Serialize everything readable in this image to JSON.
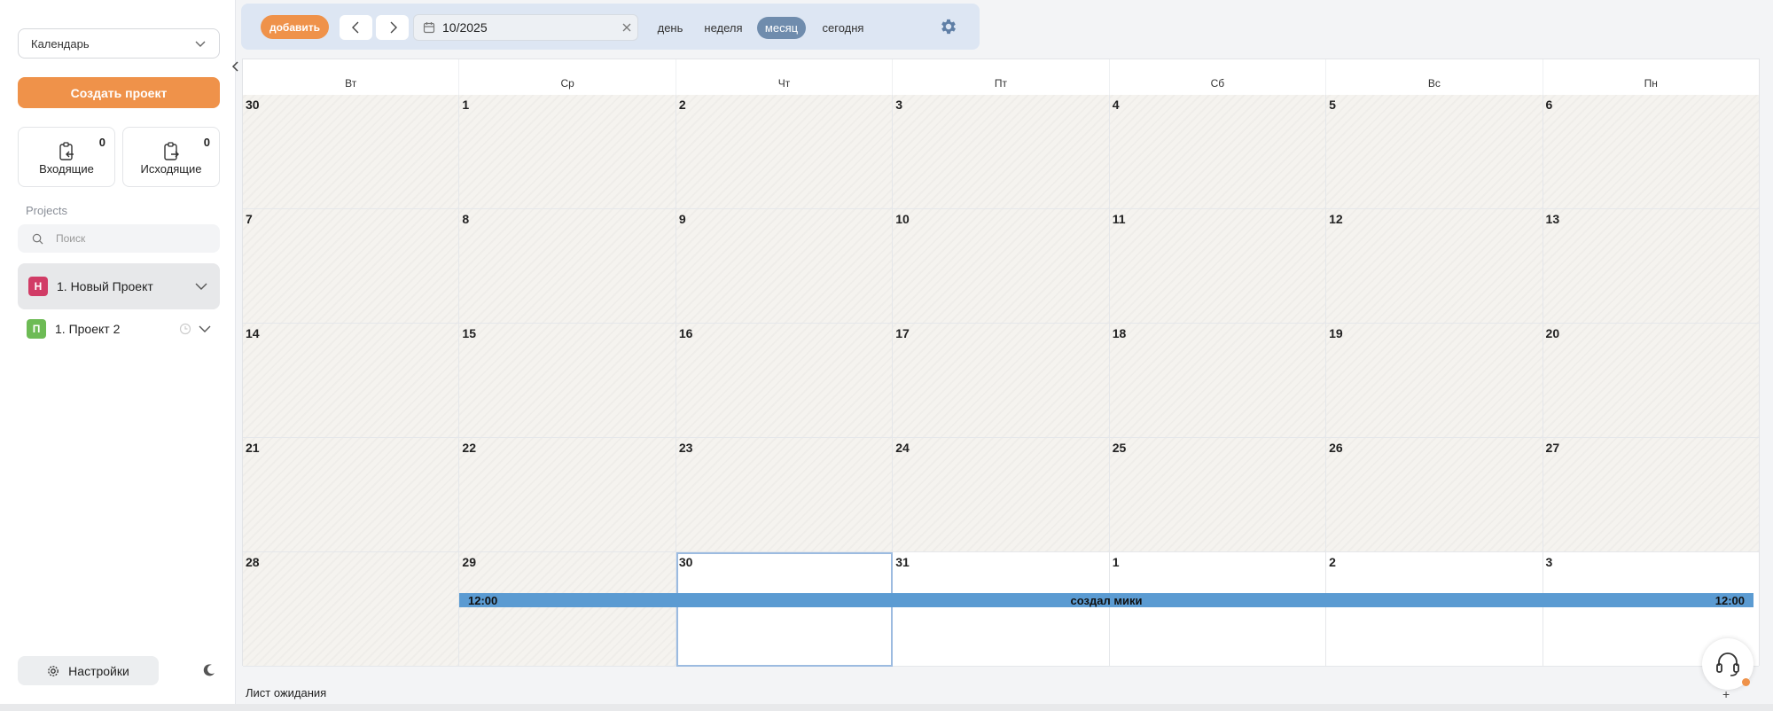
{
  "sidebar": {
    "calendar_select": "Календарь",
    "create_project": "Создать проект",
    "incoming": {
      "label": "Входящие",
      "count": "0"
    },
    "outgoing": {
      "label": "Исходящие",
      "count": "0"
    },
    "projects_label": "Projects",
    "search_placeholder": "Поиск",
    "projects": [
      {
        "badge": "Н",
        "name": "1. Новый Проект",
        "color": "#d13c66"
      },
      {
        "badge": "П",
        "name": "1. Проект 2",
        "color": "#6dbb55"
      }
    ],
    "settings_label": "Настройки"
  },
  "toolbar": {
    "add_label": "добавить",
    "date_value": "10/2025",
    "views": {
      "day": "день",
      "week": "неделя",
      "month": "месяц",
      "today": "сегодня"
    },
    "active_view": "месяц"
  },
  "calendar": {
    "weekdays": [
      "Вт",
      "Ср",
      "Чт",
      "Пт",
      "Сб",
      "Вс",
      "Пн"
    ],
    "weeks": [
      [
        "30",
        "1",
        "2",
        "3",
        "4",
        "5",
        "6"
      ],
      [
        "7",
        "8",
        "9",
        "10",
        "11",
        "12",
        "13"
      ],
      [
        "14",
        "15",
        "16",
        "17",
        "18",
        "19",
        "20"
      ],
      [
        "21",
        "22",
        "23",
        "24",
        "25",
        "26",
        "27"
      ],
      [
        "28",
        "29",
        "30",
        "31",
        "1",
        "2",
        "3"
      ]
    ],
    "selected_day": "30",
    "event": {
      "title": "создал мики",
      "start_time": "12:00",
      "end_time": "12:00",
      "color": "#5b9bd2"
    }
  },
  "footer": {
    "waiting_list": "Лист ожидания",
    "plus": "+"
  },
  "colors": {
    "accent": "#ef924a",
    "toolbar_bg": "#dde6f3",
    "active_view": "#6f8cad"
  }
}
